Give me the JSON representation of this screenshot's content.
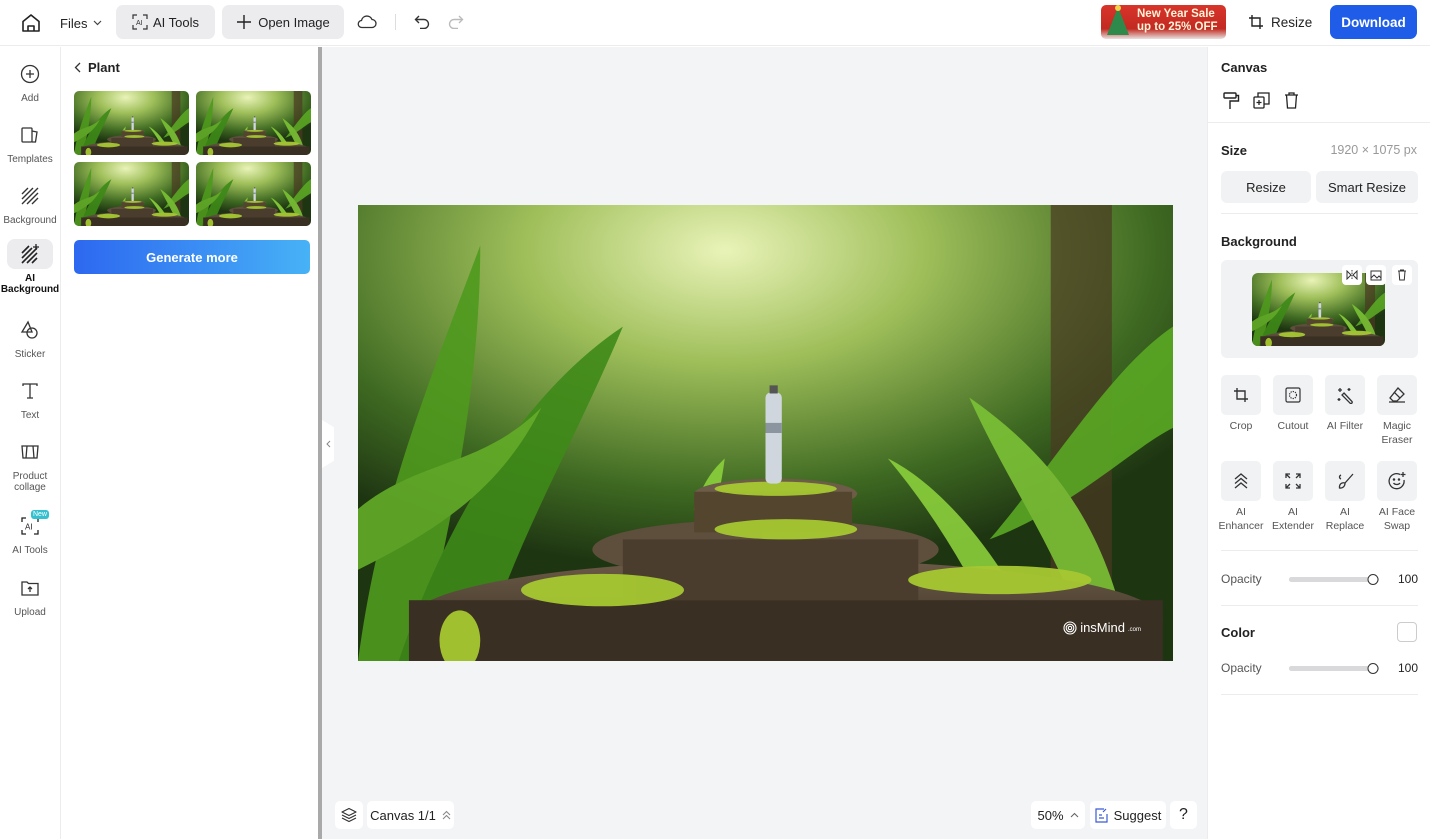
{
  "topbar": {
    "files_label": "Files",
    "ai_tools_label": "AI Tools",
    "open_image_label": "Open Image",
    "promo_line1": "New Year Sale",
    "promo_line2": "up to 25% OFF",
    "resize_label": "Resize",
    "download_label": "Download"
  },
  "sidebar": {
    "items": [
      {
        "label": "Add",
        "icon": "plus-circle-icon"
      },
      {
        "label": "Templates",
        "icon": "templates-icon"
      },
      {
        "label": "Background",
        "icon": "background-hatch-icon"
      },
      {
        "label": "AI Background",
        "icon": "ai-background-icon",
        "active": true
      },
      {
        "label": "Sticker",
        "icon": "sticker-icon"
      },
      {
        "label": "Text",
        "icon": "text-icon"
      },
      {
        "label": "Product collage",
        "icon": "collage-icon"
      },
      {
        "label": "AI Tools",
        "icon": "ai-tools-icon",
        "badge": "New"
      },
      {
        "label": "Upload",
        "icon": "upload-icon"
      }
    ]
  },
  "panel": {
    "title": "Plant",
    "thumbnails": [
      "Plant result 1",
      "Plant result 2",
      "Plant result 3",
      "Plant result 4"
    ],
    "generate_more_label": "Generate more"
  },
  "canvas": {
    "watermark": "insMind",
    "watermark_suffix": ".com",
    "page_label": "Canvas 1/1",
    "zoom": "50%",
    "suggest_label": "Suggest",
    "help_label": "?"
  },
  "rightpanel": {
    "canvas_title": "Canvas",
    "size_title": "Size",
    "size_value": "1920 × 1075 px",
    "resize_label": "Resize",
    "smart_resize_label": "Smart Resize",
    "background_title": "Background",
    "tools": [
      {
        "label": "Crop",
        "icon": "crop-icon"
      },
      {
        "label": "Cutout",
        "icon": "cutout-icon"
      },
      {
        "label": "AI Filter",
        "icon": "magic-wand-icon"
      },
      {
        "label": "Magic Eraser",
        "icon": "eraser-icon"
      },
      {
        "label": "AI Enhancer",
        "icon": "enhance-chevrons-icon"
      },
      {
        "label": "AI Extender",
        "icon": "expand-icon"
      },
      {
        "label": "AI Replace",
        "icon": "brush-icon"
      },
      {
        "label": "AI Face Swap",
        "icon": "face-icon"
      }
    ],
    "opacity_label": "Opacity",
    "bg_opacity": 100,
    "color_title": "Color",
    "color_opacity_label": "Opacity",
    "color_opacity": 100,
    "color_value": "#ffffff"
  }
}
